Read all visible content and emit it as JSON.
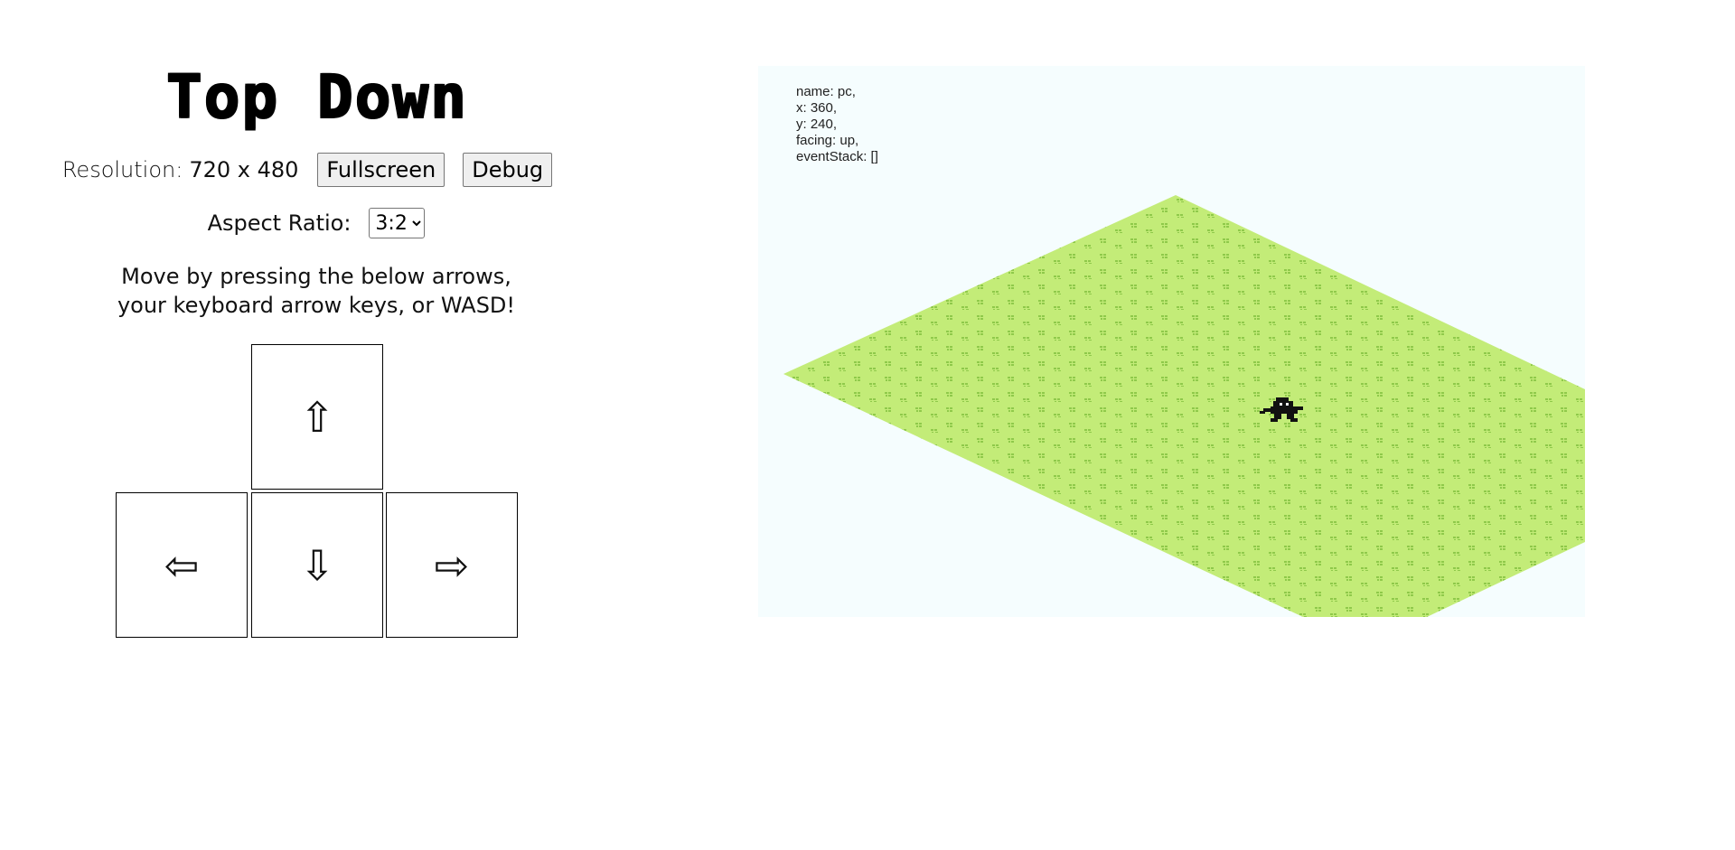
{
  "title": "Top Down",
  "resolution": {
    "label": "Resolution:",
    "value": "720 x 480"
  },
  "buttons": {
    "fullscreen": "Fullscreen",
    "debug": "Debug"
  },
  "aspect_ratio": {
    "label": "Aspect Ratio:",
    "selected": "3:2"
  },
  "instructions": {
    "line1": "Move by pressing the below arrows,",
    "line2": "your keyboard arrow keys, or WASD!"
  },
  "arrow_keys": {
    "up": "⇧",
    "left": "⇦",
    "down": "⇩",
    "right": "⇨"
  },
  "debug_overlay": {
    "name": "name: pc,",
    "x": "x: 360,",
    "y": "y: 240,",
    "facing": "facing: up,",
    "event_stack": "eventStack: []"
  },
  "colors": {
    "canvas_background": "#f5fdfe",
    "grass": "#c3ec78",
    "grass_tuft": "#8fc94a",
    "player": "#111111"
  },
  "icons": {
    "player": "player-sprite",
    "ground": "grass-tile"
  }
}
